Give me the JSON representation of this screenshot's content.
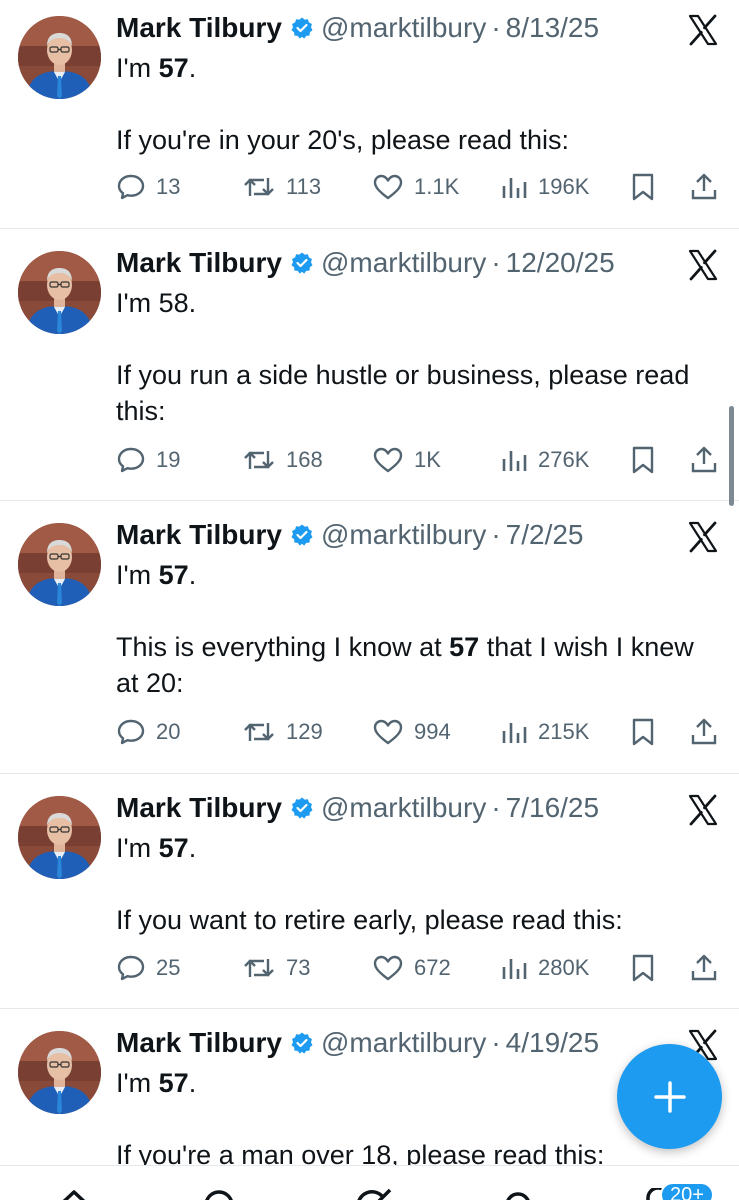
{
  "author": {
    "name": "Mark Tilbury",
    "handle": "@marktilbury",
    "separator": "·"
  },
  "icons": {
    "reply": "reply-icon",
    "repost": "repost-icon",
    "like": "like-icon",
    "views": "views-icon",
    "bookmark": "bookmark-icon",
    "share": "share-icon",
    "source": "x-logo-icon"
  },
  "colors": {
    "accent": "#1d9bf0",
    "muted": "#536471",
    "text": "#0f1419"
  },
  "tweets": [
    {
      "date": "8/13/25",
      "line1": {
        "pre": "I'm ",
        "bold": "57",
        "post": "."
      },
      "line2": {
        "pre": "If you're in your 20's, please read this:",
        "bold": "",
        "post": ""
      },
      "replies": "13",
      "reposts": "113",
      "likes": "1.1K",
      "views": "196K"
    },
    {
      "date": "12/20/25",
      "line1": {
        "pre": "I'm 58.",
        "bold": "",
        "post": ""
      },
      "line2": {
        "pre": "If you run a side hustle or business, please read this:",
        "bold": "",
        "post": ""
      },
      "replies": "19",
      "reposts": "168",
      "likes": "1K",
      "views": "276K"
    },
    {
      "date": "7/2/25",
      "line1": {
        "pre": "I'm ",
        "bold": "57",
        "post": "."
      },
      "line2": {
        "pre": "This is everything I know at ",
        "bold": "57",
        "post": " that I wish I knew at 20:"
      },
      "replies": "20",
      "reposts": "129",
      "likes": "994",
      "views": "215K"
    },
    {
      "date": "7/16/25",
      "line1": {
        "pre": "I'm ",
        "bold": "57",
        "post": "."
      },
      "line2": {
        "pre": "If you want to retire early, please read this:",
        "bold": "",
        "post": ""
      },
      "replies": "25",
      "reposts": "73",
      "likes": "672",
      "views": "280K"
    },
    {
      "date": "4/19/25",
      "line1": {
        "pre": "I'm ",
        "bold": "57",
        "post": "."
      },
      "line2": {
        "pre": "If you're a man over 18, please read this:",
        "bold": "",
        "post": ""
      }
    }
  ],
  "compose": {
    "icon": "plus-icon"
  },
  "bottom_nav": {
    "items": [
      "home-icon",
      "search-icon",
      "grok-icon",
      "communities-icon",
      "notifications-icon"
    ],
    "notifications_badge": "20+"
  }
}
